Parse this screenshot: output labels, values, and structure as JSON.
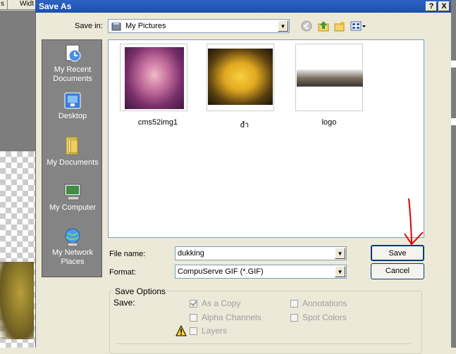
{
  "background": {
    "top_text_left": "s",
    "top_text_right": "Widt"
  },
  "dialog": {
    "title": "Save As",
    "help_btn": "?",
    "close_btn": "X"
  },
  "save_in": {
    "label": "Save in:",
    "value": "My Pictures"
  },
  "places": [
    {
      "label": "My Recent Documents",
      "icon": "recent-documents-icon"
    },
    {
      "label": "Desktop",
      "icon": "desktop-icon"
    },
    {
      "label": "My Documents",
      "icon": "my-documents-icon"
    },
    {
      "label": "My Computer",
      "icon": "my-computer-icon"
    },
    {
      "label": "My Network Places",
      "icon": "network-places-icon"
    }
  ],
  "files": [
    {
      "name": "cms52img1"
    },
    {
      "name": "dำ"
    },
    {
      "name": "logo"
    }
  ],
  "file_name": {
    "label": "File name:",
    "value": "dukking"
  },
  "format": {
    "label": "Format:",
    "value": "CompuServe GIF (*.GIF)"
  },
  "buttons": {
    "save": "Save",
    "cancel": "Cancel"
  },
  "save_options": {
    "legend": "Save Options",
    "save_label": "Save:",
    "as_a_copy": "As a Copy",
    "alpha_channels": "Alpha Channels",
    "layers": "Layers",
    "annotations": "Annotations",
    "spot_colors": "Spot Colors",
    "as_a_copy_checked": true
  },
  "colors": {
    "title_bar": "#1C4FAF",
    "dialog_bg": "#ECE9D8",
    "annotation_arrow": "#E00000"
  }
}
